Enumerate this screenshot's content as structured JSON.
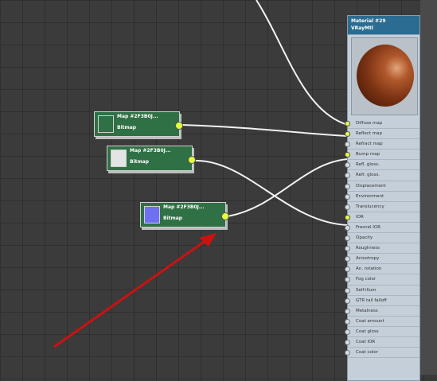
{
  "material": {
    "title": "Material #29",
    "type": "VRayMtl",
    "slots": [
      {
        "label": "Diffuse map",
        "connected": true
      },
      {
        "label": "Reflect map",
        "connected": true
      },
      {
        "label": "Refract map",
        "connected": false
      },
      {
        "label": "Bump map",
        "connected": true
      },
      {
        "label": "Refl. gloss.",
        "connected": false
      },
      {
        "label": "Refr. gloss.",
        "connected": false
      },
      {
        "label": "Displacement",
        "connected": false
      },
      {
        "label": "Environment",
        "connected": false
      },
      {
        "label": "Translucency",
        "connected": false
      },
      {
        "label": "IOR",
        "connected": true
      },
      {
        "label": "Fresnel IOR",
        "connected": false
      },
      {
        "label": "Opacity",
        "connected": false
      },
      {
        "label": "Roughness",
        "connected": false
      },
      {
        "label": "Anisotropy",
        "connected": false
      },
      {
        "label": "An. rotation",
        "connected": false
      },
      {
        "label": "Fog color",
        "connected": false
      },
      {
        "label": "Self-illum",
        "connected": false
      },
      {
        "label": "GTR tail falloff",
        "connected": false
      },
      {
        "label": "Metalness",
        "connected": false
      },
      {
        "label": "Coat amount",
        "connected": false
      },
      {
        "label": "Coat gloss",
        "connected": false
      },
      {
        "label": "Coat IOR",
        "connected": false
      },
      {
        "label": "Coat color",
        "connected": false
      }
    ]
  },
  "maps": [
    {
      "title": "Map #2F3B0J...",
      "subtitle": "Bitmap",
      "swatch": "#2f7045"
    },
    {
      "title": "Map #2F3B0J...",
      "subtitle": "Bitmap",
      "swatch": "#e4e4e4"
    },
    {
      "title": "Map #2F3B0J...",
      "subtitle": "Bitmap",
      "swatch": "#6f6ff2"
    }
  ],
  "colors": {
    "wire": "#f2f2f2",
    "socket": "#e6ff3a",
    "arrow": "#cc1111",
    "map_node": "#2f7045",
    "material_header": "#2a6c92"
  }
}
